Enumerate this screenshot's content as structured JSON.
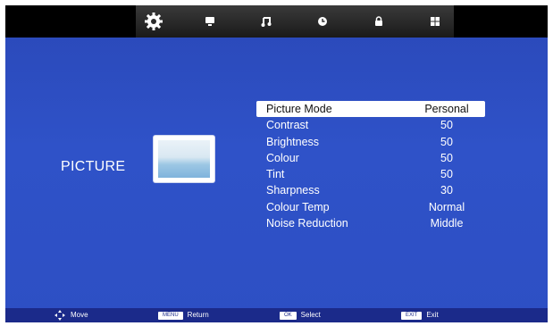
{
  "tabs": [
    {
      "name": "picture",
      "icon": "gear-icon",
      "active": true
    },
    {
      "name": "sound",
      "icon": "monitor-icon"
    },
    {
      "name": "music",
      "icon": "music-note-icon"
    },
    {
      "name": "time",
      "icon": "clock-icon"
    },
    {
      "name": "lock",
      "icon": "lock-icon"
    },
    {
      "name": "channel",
      "icon": "grid-icon"
    }
  ],
  "menu": {
    "title": "PICTURE",
    "items": [
      {
        "label": "Picture Mode",
        "value": "Personal"
      },
      {
        "label": "Contrast",
        "value": "50"
      },
      {
        "label": "Brightness",
        "value": "50"
      },
      {
        "label": "Colour",
        "value": "50"
      },
      {
        "label": "Tint",
        "value": "50"
      },
      {
        "label": "Sharpness",
        "value": "30"
      },
      {
        "label": "Colour Temp",
        "value": "Normal"
      },
      {
        "label": "Noise Reduction",
        "value": "Middle"
      }
    ]
  },
  "footer": {
    "move_label": "Move",
    "menu_key": "MENU",
    "return_label": "Return",
    "ok_key": "OK",
    "select_label": "Select",
    "exit_key": "EXIT",
    "exit_label": "Exit"
  },
  "colors": {
    "background": "#2f52c8",
    "highlight": "#ffffff",
    "footer": "#1b2a8a"
  }
}
